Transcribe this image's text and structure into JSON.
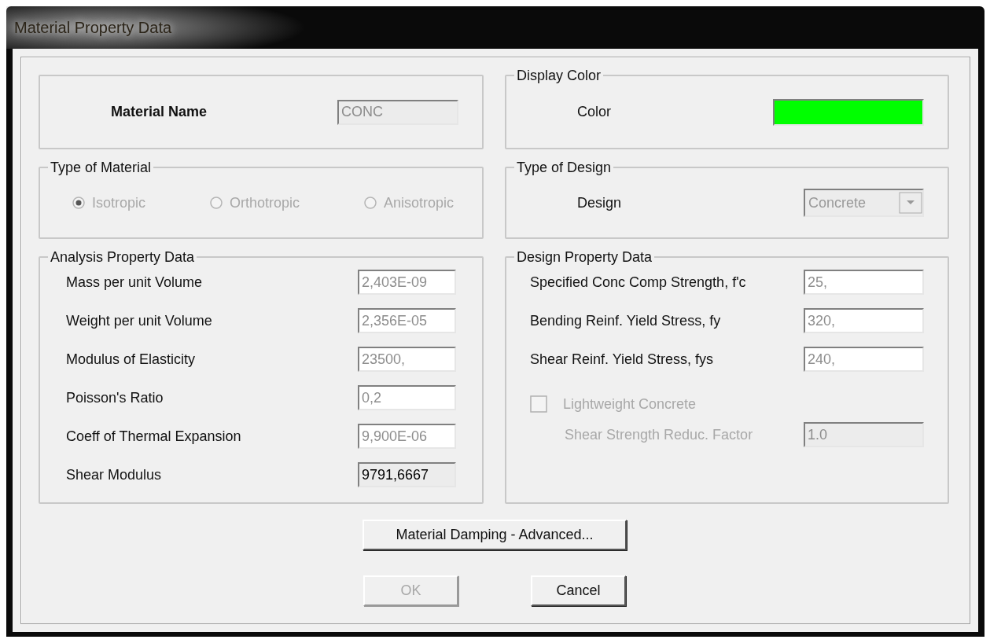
{
  "window": {
    "title": "Material Property Data"
  },
  "material_name": {
    "label": "Material Name",
    "value": "CONC",
    "disabled": true
  },
  "display_color": {
    "title": "Display Color",
    "label": "Color",
    "color": "#00ff00"
  },
  "type_of_material": {
    "title": "Type of Material",
    "disabled": true,
    "options": [
      {
        "label": "Isotropic",
        "selected": true
      },
      {
        "label": "Orthotropic",
        "selected": false
      },
      {
        "label": "Anisotropic",
        "selected": false
      }
    ]
  },
  "type_of_design": {
    "title": "Type of Design",
    "label": "Design",
    "value": "Concrete",
    "disabled": true
  },
  "analysis_property_data": {
    "title": "Analysis Property Data",
    "fields": [
      {
        "label": "Mass per unit Volume",
        "value": "2,403E-09",
        "readonly": false
      },
      {
        "label": "Weight per unit Volume",
        "value": "2,356E-05",
        "readonly": false
      },
      {
        "label": "Modulus of Elasticity",
        "value": "23500,",
        "readonly": false
      },
      {
        "label": "Poisson's Ratio",
        "value": "0,2",
        "readonly": false
      },
      {
        "label": "Coeff of Thermal Expansion",
        "value": "9,900E-06",
        "readonly": false
      },
      {
        "label": "Shear Modulus",
        "value": "9791,6667",
        "readonly": true
      }
    ]
  },
  "design_property_data": {
    "title": "Design Property Data",
    "fields": [
      {
        "label": "Specified Conc Comp Strength, f'c",
        "value": "25,",
        "disabled": false
      },
      {
        "label": "Bending Reinf. Yield Stress, fy",
        "value": "320,",
        "disabled": false
      },
      {
        "label": "Shear Reinf. Yield Stress, fys",
        "value": "240,",
        "disabled": false
      }
    ],
    "lightweight": {
      "label": "Lightweight Concrete",
      "checked": false,
      "disabled": true
    },
    "reduction_factor": {
      "label": "Shear Strength Reduc. Factor",
      "value": "1.0",
      "disabled": true
    }
  },
  "buttons": [
    {
      "kind": "wide",
      "label": "Material Damping - Advanced...",
      "disabled": false
    },
    {
      "kind": "normal",
      "label": "OK",
      "disabled": true
    },
    {
      "kind": "normal",
      "label": "Cancel",
      "disabled": false
    }
  ]
}
